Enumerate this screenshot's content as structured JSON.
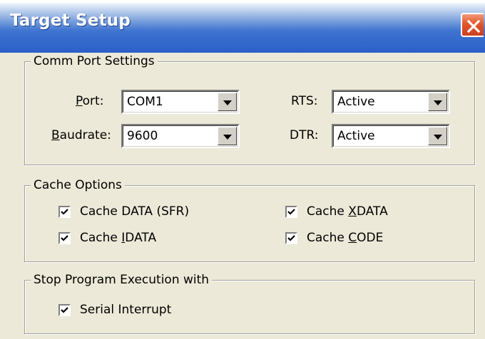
{
  "window": {
    "title": "Target Setup",
    "close_icon": "close-x-icon"
  },
  "comm": {
    "legend": "Comm Port Settings",
    "port": {
      "label_pre": "",
      "label_u": "P",
      "label_post": "ort:",
      "value": "COM1"
    },
    "baud": {
      "label_pre": "",
      "label_u": "B",
      "label_post": "audrate:",
      "value": "9600"
    },
    "rts": {
      "label": "RTS:",
      "value": "Active"
    },
    "dtr": {
      "label": "DTR:",
      "value": "Active"
    }
  },
  "cache": {
    "legend": "Cache Options",
    "data_sfr": {
      "pre": "Cache DATA (SFR)",
      "u": "",
      "post": "",
      "checked": true
    },
    "xdata": {
      "pre": "Cache ",
      "u": "X",
      "post": "DATA",
      "checked": true
    },
    "idata": {
      "pre": "Cache ",
      "u": "I",
      "post": "DATA",
      "checked": true
    },
    "code": {
      "pre": "Cache ",
      "u": "C",
      "post": "ODE",
      "checked": true
    }
  },
  "stop": {
    "legend": "Stop Program Execution with",
    "serial": {
      "label": "Serial Interrupt",
      "checked": true
    }
  }
}
